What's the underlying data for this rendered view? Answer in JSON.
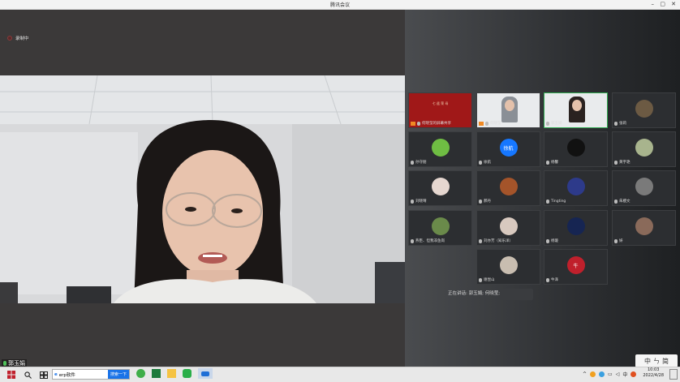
{
  "window": {
    "title": "腾讯会议",
    "min": "–",
    "max": "▢",
    "close": "✕"
  },
  "recording": {
    "label": "录制中"
  },
  "main_speaker": {
    "name": "郭玉娟"
  },
  "participants": [
    {
      "name": "何晓莹的屏幕共享",
      "banner": "七 遥 荣 母",
      "avatar_bg": "#a01818"
    },
    {
      "name": "何晓莹",
      "avatar_bg": "#c9c9c9"
    },
    {
      "name": "郭玉娟",
      "avatar_bg": "#ddd"
    },
    {
      "name": "张莉",
      "avatar_bg": "#6c5a43"
    },
    {
      "name": "孙守朋",
      "avatar_bg": "#6fbd43"
    },
    {
      "name": "徐航",
      "avatar_text": "徐航",
      "avatar_bg": "#1677ff"
    },
    {
      "name": "杨馨",
      "avatar_bg": "#111"
    },
    {
      "name": "黄宇艳",
      "avatar_bg": "#a8b48d"
    },
    {
      "name": "刘晓晴",
      "avatar_bg": "#e6d7d0"
    },
    {
      "name": "郝丹",
      "avatar_bg": "#a4542a"
    },
    {
      "name": "Tingting",
      "avatar_bg": "#2d3a8a"
    },
    {
      "name": "朱稷文",
      "avatar_bg": "#7a7a7a"
    },
    {
      "name": "燕臣、但我非鱼岗",
      "avatar_bg": "#6a8a4a"
    },
    {
      "name": "刘亦芳（知乐洋）",
      "avatar_bg": "#d8c9bf"
    },
    {
      "name": "杨璇",
      "avatar_bg": "#162552"
    },
    {
      "name": "妍",
      "avatar_bg": "#8a6a5a"
    },
    {
      "name": "谢昆山",
      "avatar_bg": "#c8bdb0"
    },
    {
      "name": "牛泽",
      "avatar_text": "牛",
      "avatar_bg": "#c0202c"
    }
  ],
  "speaking_now": "正在讲话: 郭玉娟; 何晓莹;",
  "ime": {
    "text1": "中",
    "text2": "ㄣ",
    "text3": "简"
  },
  "taskbar": {
    "search_placeholder": "erp软件",
    "search_button": "搜索一下",
    "time": "10:03",
    "date": "2022/4/28",
    "lang": "中"
  }
}
